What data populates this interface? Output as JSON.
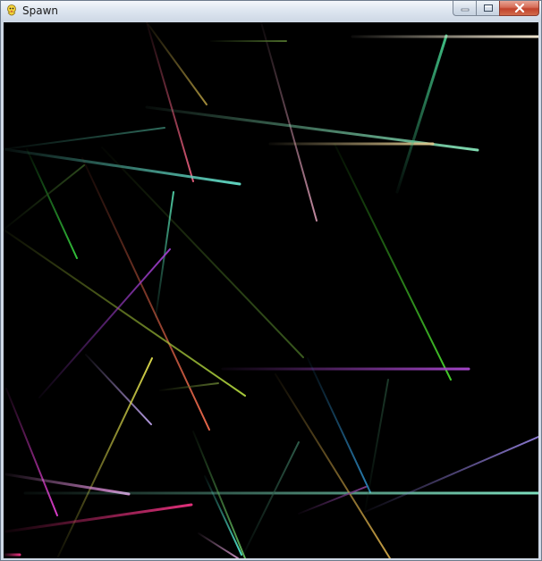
{
  "window": {
    "title": "Spawn",
    "icon": "pygame-snake-icon",
    "caption_buttons": {
      "minimize": "minimize-icon",
      "maximize": "maximize-icon",
      "close": "close-icon"
    }
  },
  "canvas": {
    "background": "#000000"
  }
}
